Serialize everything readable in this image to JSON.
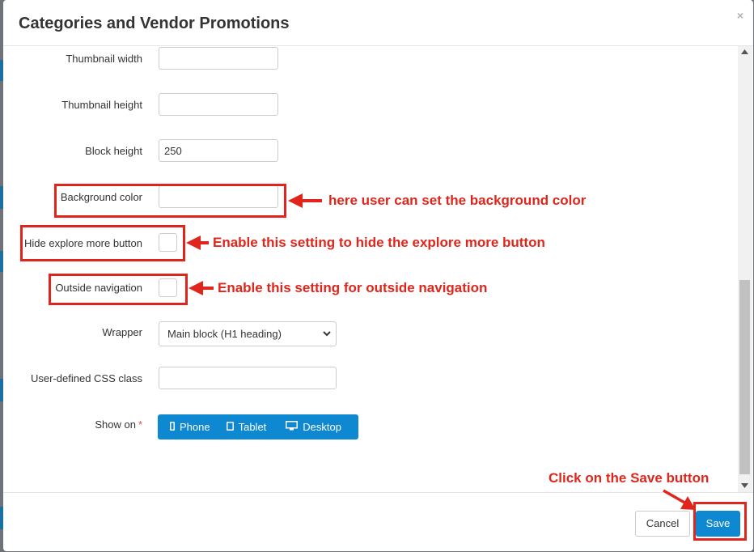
{
  "modal": {
    "title": "Categories and Vendor Promotions",
    "close_glyph": "×"
  },
  "form": {
    "thumbnail_width": {
      "label": "Thumbnail width",
      "value": ""
    },
    "thumbnail_height": {
      "label": "Thumbnail height",
      "value": ""
    },
    "block_height": {
      "label": "Block height",
      "value": "250"
    },
    "background_color": {
      "label": "Background color",
      "value": ""
    },
    "hide_explore_more": {
      "label": "Hide explore more button",
      "checked": false
    },
    "outside_navigation": {
      "label": "Outside navigation",
      "checked": false
    },
    "wrapper": {
      "label": "Wrapper",
      "selected": "Main block (H1 heading)"
    },
    "css_class": {
      "label": "User-defined CSS class",
      "value": ""
    },
    "show_on": {
      "label": "Show on",
      "required_mark": "*",
      "options": [
        {
          "label": "Phone",
          "icon": "phone-icon"
        },
        {
          "label": "Tablet",
          "icon": "tablet-icon"
        },
        {
          "label": "Desktop",
          "icon": "desktop-icon"
        }
      ]
    }
  },
  "footer": {
    "cancel_label": "Cancel",
    "save_label": "Save"
  },
  "annotations": {
    "background_color_note": "here user can set the background color",
    "hide_explore_note": "Enable this setting to hide the explore more button",
    "outside_navigation_note": "Enable this setting for outside navigation",
    "save_note": "Click on the Save button"
  },
  "colors": {
    "primary": "#0e88d0",
    "annotation": "#e0261c",
    "required": "#d9534f"
  }
}
